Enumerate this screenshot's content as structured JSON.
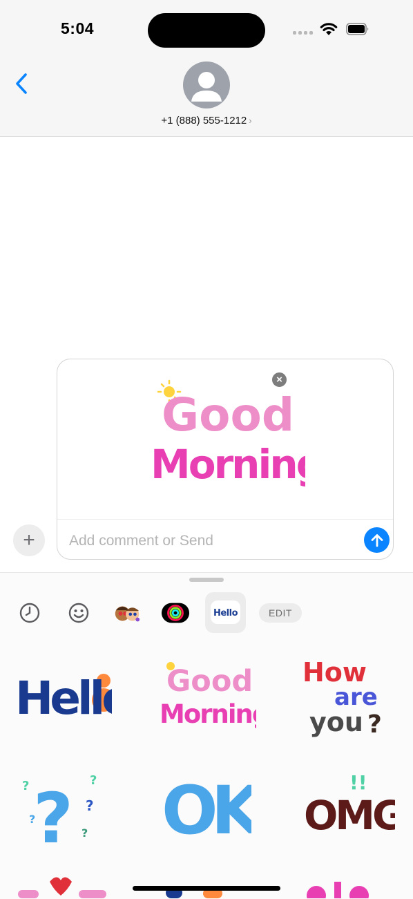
{
  "status_bar": {
    "time": "5:04",
    "icons": [
      "cellular-signal-icon",
      "wifi-icon",
      "battery-icon"
    ]
  },
  "header": {
    "back_icon": "chevron-left-icon",
    "contact": "+1 (888) 555-1212",
    "contact_chevron": "›",
    "avatar_icon": "person-icon"
  },
  "compose": {
    "attached_sticker": {
      "name": "good-morning-sticker",
      "lines": [
        "Good",
        "Morning"
      ]
    },
    "remove_icon": "×",
    "placeholder": "Add comment or Send",
    "value": "",
    "plus_label": "+",
    "send_icon": "arrow-up-icon"
  },
  "drawer": {
    "tabs": [
      {
        "name": "recents",
        "icon": "clock-icon"
      },
      {
        "name": "emoji",
        "icon": "smiley-icon"
      },
      {
        "name": "memoji",
        "icon": "memoji-icon"
      },
      {
        "name": "activity",
        "icon": "activity-rings-icon"
      },
      {
        "name": "hello-pack",
        "label": "Hello",
        "selected": true
      }
    ],
    "edit_label": "EDIT",
    "stickers": [
      {
        "lines": [
          "Hello"
        ]
      },
      {
        "lines": [
          "Good",
          "Morning"
        ]
      },
      {
        "lines": [
          "How",
          "are",
          "you",
          "?"
        ]
      },
      {
        "lines": [
          "?"
        ]
      },
      {
        "lines": [
          "OK"
        ]
      },
      {
        "lines": [
          "!!",
          "OMG"
        ]
      }
    ],
    "partial_row": [
      "miss-sticker",
      "cut-off-sticker",
      "dad-sticker"
    ]
  },
  "colors": {
    "accent": "#0a84ff",
    "bar_background": "#f6f6f6",
    "drawer_background": "#fbfbfb"
  }
}
